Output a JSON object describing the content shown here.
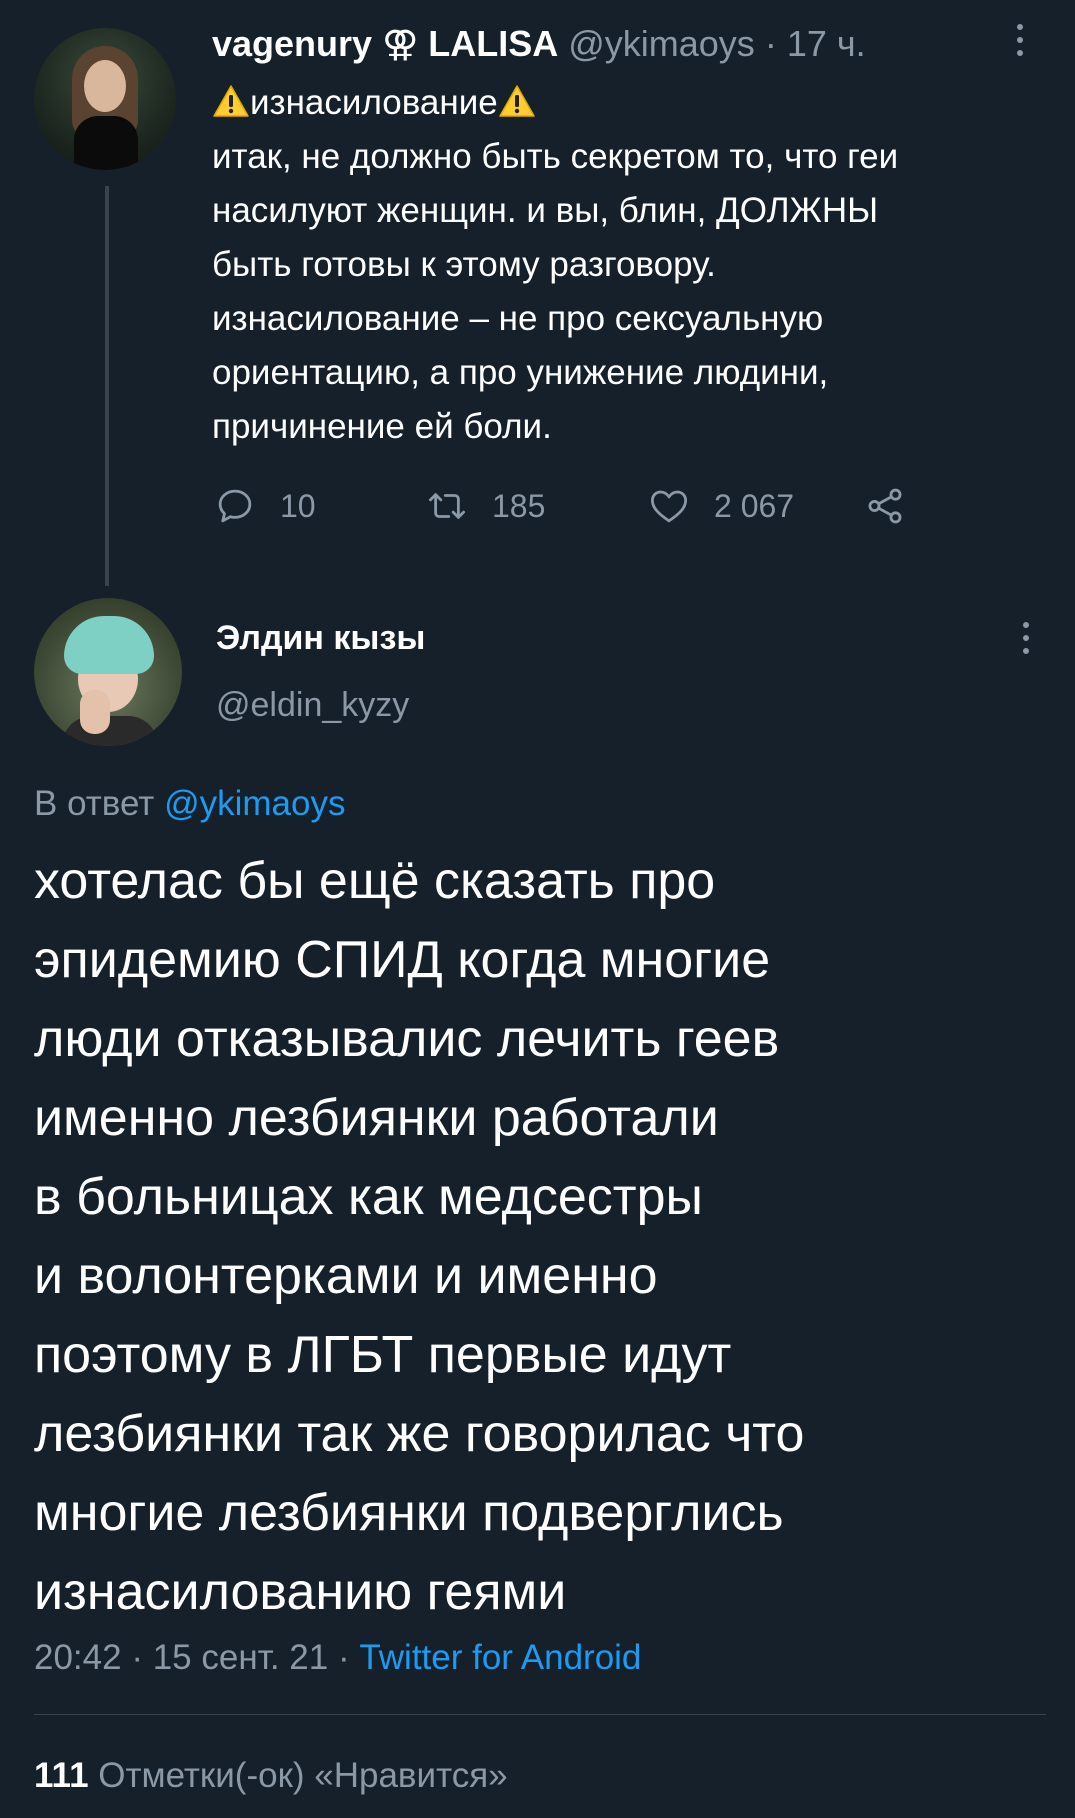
{
  "parent_tweet": {
    "display_name": "vagenury ⚢ LALISA",
    "handle": "@ykimaoys",
    "time_ago": "17 ч.",
    "text_lines": [
      "изнасилование",
      "итак, не должно быть секретом то, что геи",
      "насилуют женщин. и вы, блин, ДОЛЖНЫ",
      "быть готовы к этому разговору.",
      "изнасилование – не про сексуальную",
      "ориентацию, а про унижение людини,",
      "причинение ей боли."
    ],
    "replies": "10",
    "retweets": "185",
    "likes": "2 067",
    "icons": {
      "more": "more-vertical-icon",
      "warning": "warning-icon",
      "reply": "reply-icon",
      "retweet": "retweet-icon",
      "like": "heart-icon",
      "share": "share-icon"
    }
  },
  "reply_tweet": {
    "display_name": "Элдин кызы",
    "handle": "@eldin_kyzy",
    "reply_to_prefix": "В ответ",
    "reply_to_mention": "@ykimaoys",
    "text_lines": [
      "хотелас бы ещё сказать про",
      "эпидемию СПИД когда многие",
      "люди отказывалис лечить геев",
      "именно лезбиянки работали",
      "в больницах как медсестры",
      "и волонтерками и именно",
      "поэтому в ЛГБТ первые идут",
      "лезбиянки так же говорилас что",
      "многие лезбиянки подверглись",
      "изнасилованию геями"
    ],
    "time": "20:42",
    "date": "15 сент. 21",
    "source": "Twitter for Android",
    "likes_count": "111",
    "likes_label": "Отметки(-ок) «Нравится»"
  },
  "colors": {
    "background": "#15202b",
    "primary_text": "#ffffff",
    "secondary_text": "#8b98a5",
    "accent": "#1d9bf0",
    "divider": "#38444d",
    "warning": "#ffcc32"
  }
}
